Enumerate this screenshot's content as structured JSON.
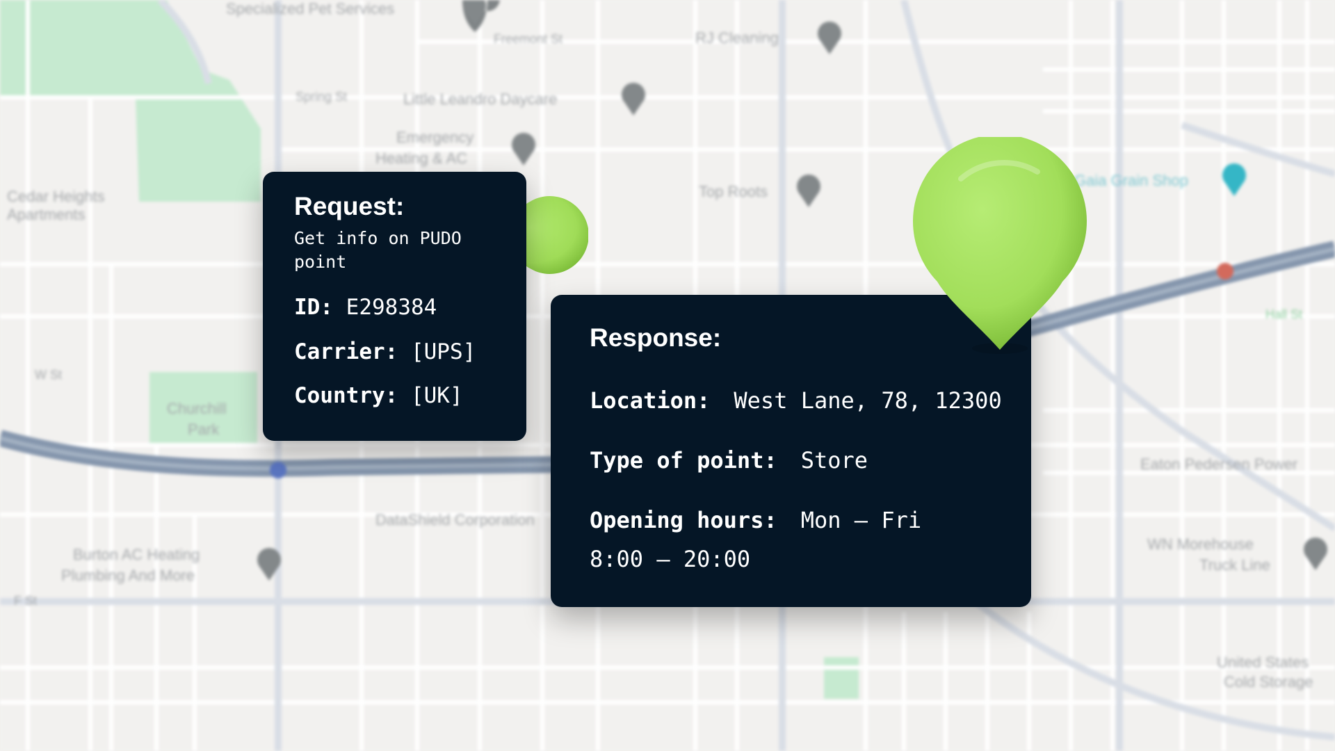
{
  "map": {
    "labels": [
      "Specialized Pet Services",
      "Freemont St",
      "RJ Cleaning",
      "Spring St",
      "Little Leandro Daycare",
      "Emergency Heating & AC",
      "Cedar Heights Apartments",
      "Top Roots",
      "Gaia Grain Shop",
      "Churchill Park",
      "DataShield Corporation",
      "Burton AC Heating Plumbing And More",
      "Eaton Pedersen Power",
      "WN Morehouse Truck Line",
      "United States Cold Storage",
      "W St",
      "F St",
      "Hall St"
    ]
  },
  "request": {
    "title": "Request:",
    "description": "Get info on PUDO point",
    "fields": [
      {
        "key": "ID:",
        "value": "E298384"
      },
      {
        "key": "Carrier:",
        "value": "[UPS]"
      },
      {
        "key": "Country:",
        "value": "[UK]"
      }
    ]
  },
  "response": {
    "title": "Response:",
    "location_label": "Location:",
    "location_value": "West Lane, 78, 12300",
    "type_label": "Type of point:",
    "type_value": "Store",
    "hours_label": "Opening hours:",
    "hours_value_line1": "Mon – Fri",
    "hours_value_line2": "8:00 – 20:00"
  },
  "colors": {
    "card_background": "#051626",
    "pin_green": "#a4e05b",
    "map_background": "#f2f1ef",
    "park_green": "#bfe6c6",
    "highway": "#8596ad"
  }
}
